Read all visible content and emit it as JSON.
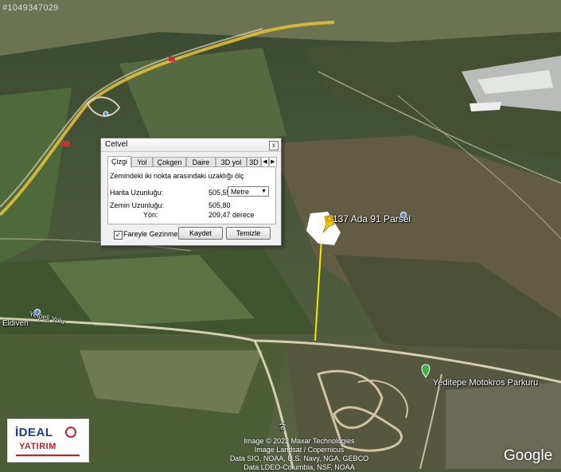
{
  "watermark_id": "#1049347029",
  "ruler": {
    "title": "Cetvel",
    "close_label": "x",
    "tabs": [
      "Çizgi",
      "Yol",
      "Çokgen",
      "Daire",
      "3D yol",
      "3D"
    ],
    "active_tab": "Çizgi",
    "description": "Zemindeki iki nokta arasındaki uzaklığı ölç",
    "map_length_label": "Harita Uzunluğu:",
    "map_length_value": "505,55",
    "unit": "Metre",
    "ground_length_label": "Zemin Uzunluğu:",
    "ground_length_value": "505,80",
    "heading_label": "Yön:",
    "heading_value": "209,47 derece",
    "mouse_nav_label": "Fareyle Gezinme",
    "mouse_nav_checked": true,
    "save_label": "Kaydet",
    "clear_label": "Temizle"
  },
  "map": {
    "parcel_label": "137 Ada 91 Parsel",
    "place_eldiven": "Eldiven",
    "road_label": "Yelpeli Yolu",
    "poi_yeditepe": "Yeditepe Motokros Parkuru",
    "road_vertical": "Ye",
    "attribution": [
      "Image © 2022 Maxar Technologies",
      "Image Landsat / Copernicus",
      "Data SIO, NOAA, U.S. Navy, NGA, GEBCO",
      "Data LDEO-Columbia, NSF, NOAA"
    ],
    "google_logo": "Google",
    "colors": {
      "measure_line": "#f5e600",
      "pin": "#f5c400",
      "road": "#e4dcc0",
      "highway": "#e8c23a"
    }
  },
  "brand": {
    "top": "İDEAL",
    "bottom": "YATIRIM"
  }
}
